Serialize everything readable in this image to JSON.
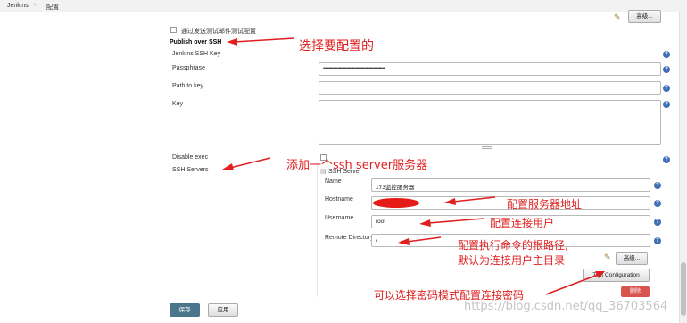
{
  "breadcrumb": {
    "home": "Jenkins",
    "separator": "›",
    "current": "配置"
  },
  "top_advanced_button": "高级...",
  "test_checkbox_label": "通过发送测试邮件测试配置",
  "section_title": "Publish over SSH",
  "fields": {
    "jenkins_ssh_key": "Jenkins SSH Key",
    "passphrase": "Passphrase",
    "passphrase_value": "•••••••••••••••••••••••••••••••••••••••••••••••••••••••",
    "path_to_key": "Path to key",
    "key": "Key",
    "disable_exec": "Disable exec",
    "ssh_servers": "SSH Servers"
  },
  "ssh_server": {
    "header": "SSH Server",
    "name_label": "Name",
    "name_value": "173监控服务器",
    "hostname_label": "Hostname",
    "hostname_value": "...",
    "username_label": "Username",
    "username_value": "root",
    "remote_dir_label": "Remote Directory",
    "remote_dir_value": "/",
    "advanced_button": "高级...",
    "test_config_button": "Test Configuration",
    "delete_button": "删除"
  },
  "buttons": {
    "save": "保存",
    "apply": "应用"
  },
  "annotations": {
    "choose_config": "选择要配置的",
    "add_server": "添加一个ssh server服务器",
    "server_address": "配置服务器地址",
    "connect_user": "配置连接用户",
    "root_path_line1": "配置执行命令的根路径,",
    "root_path_line2": "默认为连接用户主目录",
    "password_mode": "可以选择密码模式配置连接密码"
  },
  "watermark": "https://blog.csdn.net/qq_36703564",
  "colors": {
    "annotation": "#e02020",
    "help_icon": "#3e6fb6",
    "save_button": "#4b758b"
  }
}
